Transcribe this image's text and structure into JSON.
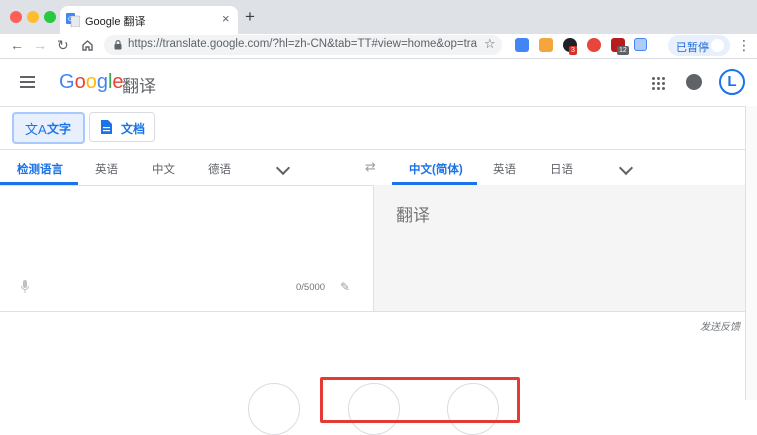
{
  "browser": {
    "tab_title": "Google 翻译",
    "tab_close": "×",
    "new_tab": "+",
    "url": "https://translate.google.com/?hl=zh-CN&tab=TT#view=home&op=tra...",
    "profile_status": "已暂停",
    "ext_badge_1": "3",
    "ext_badge_2": "12"
  },
  "app": {
    "logo": "Google",
    "logo_sub": "翻译",
    "avatar_letter": "L"
  },
  "modes": [
    {
      "label": "文字",
      "icon": "translate-icon"
    },
    {
      "label": "文档",
      "icon": "document-icon"
    }
  ],
  "source_langs": [
    "检测语言",
    "英语",
    "中文",
    "德语"
  ],
  "target_langs": [
    "中文(简体)",
    "英语",
    "日语"
  ],
  "source": {
    "counter": "0/5000"
  },
  "target": {
    "placeholder": "翻译"
  },
  "feedback": "发送反馈",
  "colors": {
    "accent": "#1a73e8",
    "highlight": "#e53935"
  }
}
